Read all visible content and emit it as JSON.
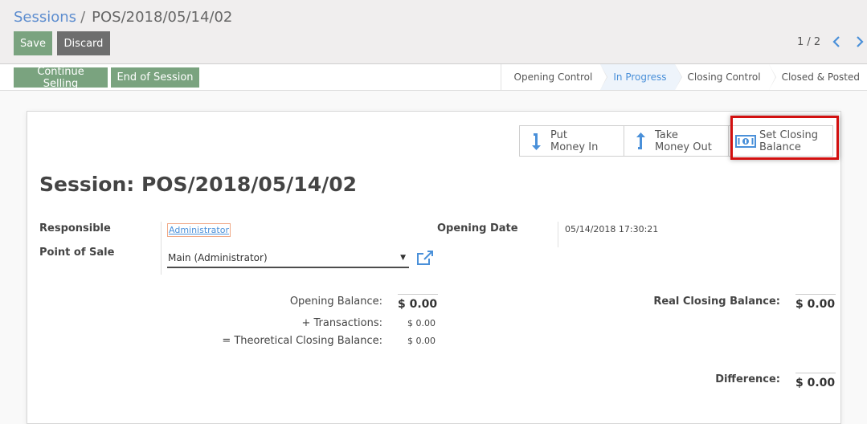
{
  "breadcrumb": {
    "parent": "Sessions",
    "separator": "/",
    "current": "POS/2018/05/14/02"
  },
  "buttons": {
    "save": "Save",
    "discard": "Discard"
  },
  "pager": {
    "value": "1 / 2"
  },
  "statusbar": {
    "continue_selling": "Continue Selling",
    "end_of_session": "End of Session",
    "stages": [
      "Opening Control",
      "In Progress",
      "Closing Control",
      "Closed & Posted"
    ],
    "active_stage": "In Progress"
  },
  "smart_buttons": [
    {
      "line1": "Put",
      "line2": "Money In",
      "icon": "arrow-down-icon"
    },
    {
      "line1": "Take",
      "line2": "Money Out",
      "icon": "arrow-up-icon"
    },
    {
      "line1": "Set Closing",
      "line2": "Balance",
      "icon": "money-icon"
    }
  ],
  "session": {
    "title": "Session: POS/2018/05/14/02",
    "responsible_label": "Responsible",
    "responsible_value": "Administrator",
    "pos_label": "Point of Sale",
    "pos_value": "Main (Administrator)",
    "opening_date_label": "Opening Date",
    "opening_date_value": "05/14/2018 17:30:21"
  },
  "balances": {
    "opening_label": "Opening Balance:",
    "opening_value": "$ 0.00",
    "transactions_label": "+ Transactions:",
    "transactions_value": "$ 0.00",
    "theoretical_label": "= Theoretical Closing Balance:",
    "theoretical_value": "$ 0.00",
    "real_closing_label": "Real Closing Balance:",
    "real_closing_value": "$ 0.00",
    "difference_label": "Difference:",
    "difference_value": "$ 0.00"
  },
  "colors": {
    "primary": "#7aa37f",
    "secondary": "#6e6e6e",
    "link": "#4a90d9",
    "highlight": "#d21010"
  }
}
